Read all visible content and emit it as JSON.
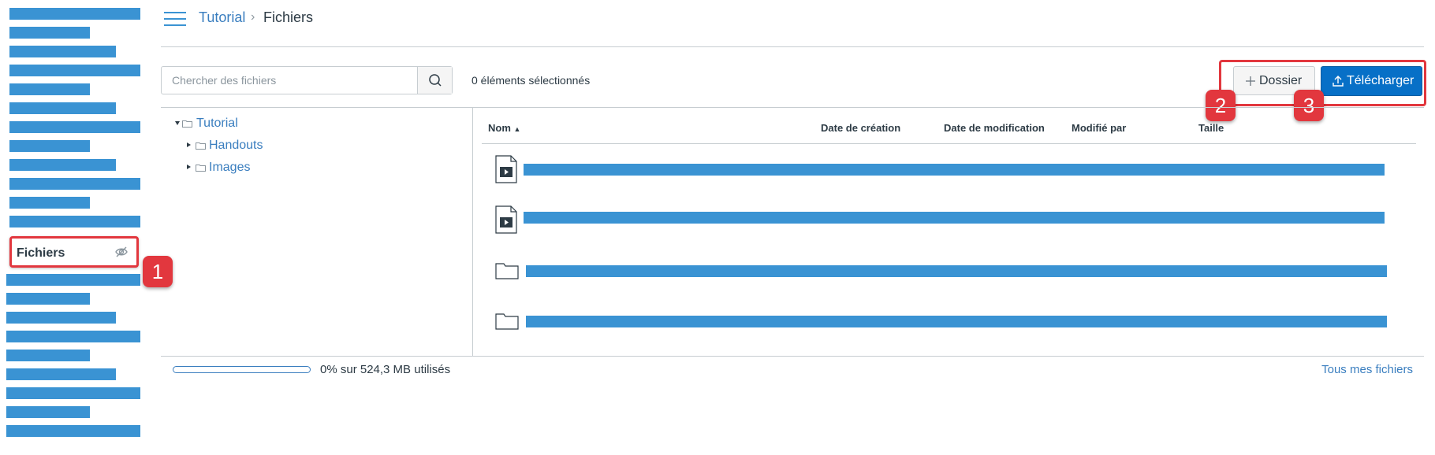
{
  "sidebar": {
    "active_item": "Fichiers",
    "active_item_icon": "eye-hidden-icon"
  },
  "callouts": {
    "one": "1",
    "two": "2",
    "three": "3"
  },
  "breadcrumb": {
    "root": "Tutorial",
    "separator": "›",
    "current": "Fichiers"
  },
  "search": {
    "placeholder": "Chercher des fichiers",
    "value": ""
  },
  "selection_status": "0 éléments sélectionnés",
  "toolbar": {
    "new_folder_label": "Dossier",
    "upload_label": "Télécharger"
  },
  "folder_tree": {
    "root": "Tutorial",
    "children": [
      "Handouts",
      "Images"
    ]
  },
  "table": {
    "columns": [
      "Nom",
      "Date de création",
      "Date de modification",
      "Modifié par",
      "Taille"
    ],
    "sort_column": "Nom",
    "sort_direction": "ascending",
    "rows": [
      {
        "type": "video-file-icon"
      },
      {
        "type": "video-file-icon"
      },
      {
        "type": "folder-icon"
      },
      {
        "type": "folder-icon"
      }
    ]
  },
  "footer": {
    "quota_text": "0% sur 524,3 MB utilisés",
    "quota_fraction": 0.0,
    "all_files_link": "Tous mes fichiers"
  },
  "colors": {
    "accent": "#3a93d3",
    "link": "#3a7ebf",
    "primary_button": "#0770c7",
    "callout": "#e2373e"
  }
}
